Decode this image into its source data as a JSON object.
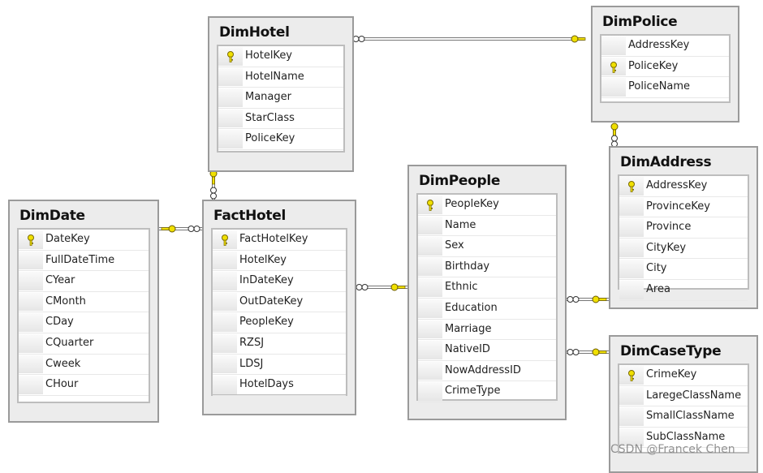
{
  "tables": [
    {
      "name": "DimHotel",
      "columns": [
        "HotelKey",
        "HotelName",
        "Manager",
        "StarClass",
        "PoliceKey"
      ],
      "primary_key": "HotelKey"
    },
    {
      "name": "DimPolice",
      "columns": [
        "AddressKey",
        "PoliceKey",
        "PoliceName"
      ],
      "primary_key": "PoliceKey"
    },
    {
      "name": "DimAddress",
      "columns": [
        "AddressKey",
        "ProvinceKey",
        "Province",
        "CityKey",
        "City",
        "Area"
      ],
      "primary_key": "AddressKey"
    },
    {
      "name": "DimCaseType",
      "columns": [
        "CrimeKey",
        "LaregeClassName",
        "SmallClassName",
        "SubClassName"
      ],
      "primary_key": "CrimeKey"
    },
    {
      "name": "DimPeople",
      "columns": [
        "PeopleKey",
        "Name",
        "Sex",
        "Birthday",
        "Ethnic",
        "Education",
        "Marriage",
        "NativeID",
        "NowAddressID",
        "CrimeType"
      ],
      "primary_key": "PeopleKey"
    },
    {
      "name": "FactHotel",
      "columns": [
        "FactHotelKey",
        "HotelKey",
        "InDateKey",
        "OutDateKey",
        "PeopleKey",
        "RZSJ",
        "LDSJ",
        "HotelDays"
      ],
      "primary_key": "FactHotelKey"
    },
    {
      "name": "DimDate",
      "columns": [
        "DateKey",
        "FullDateTime",
        "CYear",
        "CMonth",
        "CDay",
        "CQuarter",
        "Cweek",
        "CHour"
      ],
      "primary_key": "DateKey"
    }
  ],
  "relationships": [
    {
      "from": "DimHotel",
      "to": "DimPolice"
    },
    {
      "from": "DimPolice",
      "to": "DimAddress"
    },
    {
      "from": "FactHotel",
      "to": "DimHotel"
    },
    {
      "from": "FactHotel",
      "to": "DimDate"
    },
    {
      "from": "FactHotel",
      "to": "DimPeople"
    },
    {
      "from": "DimPeople",
      "to": "DimAddress"
    },
    {
      "from": "DimPeople",
      "to": "DimCaseType"
    }
  ],
  "colors": {
    "key": "#e8d800",
    "border": "#9a9a9a",
    "panel": "#ececec"
  },
  "watermark": "CSDN @Francek Chen"
}
